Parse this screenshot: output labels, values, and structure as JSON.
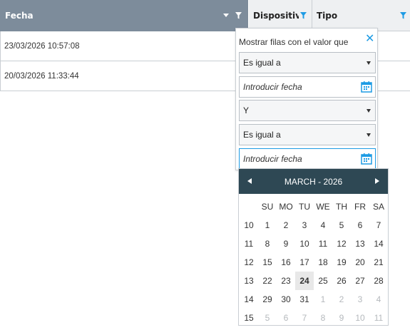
{
  "header": {
    "col_fecha": "Fecha",
    "col_dispositivo": "Dispositivo",
    "col_tipo": "Tipo"
  },
  "rows": [
    {
      "fecha": "23/03/2026 10:57:08"
    },
    {
      "fecha": "20/03/2026 11:33:44"
    }
  ],
  "filter": {
    "title": "Mostrar filas con el valor que",
    "close_label": "✕",
    "operator1": "Es igual a",
    "value1_placeholder": "Introducir fecha",
    "logic": "Y",
    "operator2": "Es igual a",
    "value2_placeholder": "Introducir fecha"
  },
  "calendar": {
    "title": "MARCH - 2026",
    "day_headers": [
      "SU",
      "MO",
      "TU",
      "WE",
      "TH",
      "FR",
      "SA"
    ],
    "weeks": [
      {
        "week": "10",
        "days": [
          "1",
          "2",
          "3",
          "4",
          "5",
          "6",
          "7"
        ]
      },
      {
        "week": "11",
        "days": [
          "8",
          "9",
          "10",
          "11",
          "12",
          "13",
          "14"
        ]
      },
      {
        "week": "12",
        "days": [
          "15",
          "16",
          "17",
          "18",
          "19",
          "20",
          "21"
        ]
      },
      {
        "week": "13",
        "days": [
          "22",
          "23",
          "24",
          "25",
          "26",
          "27",
          "28"
        ]
      },
      {
        "week": "14",
        "days": [
          "29",
          "30",
          "31",
          "1",
          "2",
          "3",
          "4"
        ]
      },
      {
        "week": "15",
        "days": [
          "5",
          "6",
          "7",
          "8",
          "9",
          "10",
          "11"
        ]
      }
    ],
    "today": "24"
  },
  "colors": {
    "header_active": "#7d8c9b",
    "accent": "#1d9be4",
    "calendar_header": "#2e4854"
  }
}
